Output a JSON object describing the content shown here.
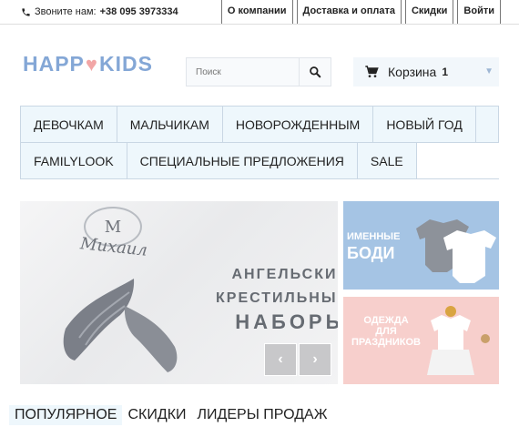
{
  "topbar": {
    "phone_label": "Звоните нам:",
    "phone_number": "+38 095 3973334",
    "links": [
      "О компании",
      "Доставка и оплата",
      "Скидки",
      "Войти"
    ]
  },
  "logo": {
    "part1": "HAPP",
    "part2": "KIDS"
  },
  "search": {
    "placeholder": "Поиск"
  },
  "cart": {
    "label": "Корзина",
    "count": "1"
  },
  "nav": {
    "row1": [
      "ДЕВОЧКАМ",
      "МАЛЬЧИКАМ",
      "НОВОРОЖДЕННЫМ",
      "НОВЫЙ ГОД"
    ],
    "row2": [
      "FAMILYLOOK",
      "СПЕЦИАЛЬНЫЕ ПРЕДЛОЖЕНИЯ",
      "SALE"
    ]
  },
  "hero": {
    "monogram": "М",
    "name": "Михаил",
    "line1": "АНГЕЛЬСКИЕ",
    "line2": "КРЕСТИЛЬНЫЕ",
    "line3": "НАБОРЫ",
    "prev": "‹",
    "next": "›"
  },
  "promo1": {
    "line1": "ИМЕННЫЕ",
    "line2": "БОДИ"
  },
  "promo2": {
    "line1": "ОДЕЖДА",
    "line2": "ДЛЯ",
    "line3": "ПРАЗДНИКОВ"
  },
  "tabs": [
    "ПОПУЛЯРНОЕ",
    "СКИДКИ",
    "ЛИДЕРЫ ПРОДАЖ"
  ],
  "colors": {
    "brand": "#84a7d6",
    "heart": "#f2a6a6",
    "nav_bg": "#eef7fc",
    "promo_blue": "#a5c4e4",
    "promo_pink": "#f7cfcc"
  }
}
